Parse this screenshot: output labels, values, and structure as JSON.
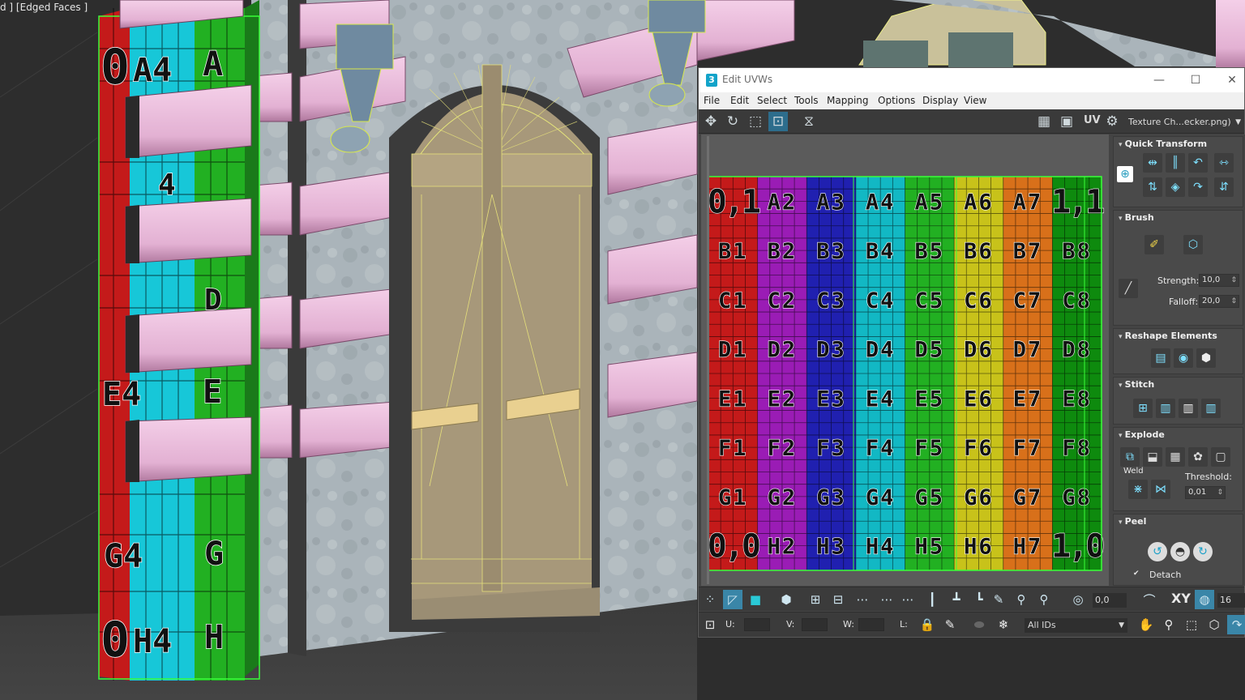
{
  "viewport": {
    "label": "d ] [Edged Faces ]",
    "left_column_labels": [
      "0",
      "A4",
      "A",
      "4",
      "D",
      "E4",
      "E",
      "G4",
      "G",
      "0",
      "H4",
      "H"
    ]
  },
  "window": {
    "logo": "3",
    "title": "Edit UVWs",
    "minimize": "—",
    "maximize": "☐",
    "close": "✕"
  },
  "menu": [
    "File",
    "Edit",
    "Select",
    "Tools",
    "Mapping",
    "Options",
    "Display",
    "View"
  ],
  "toolbar_top": {
    "uv_label": "UV",
    "texture": "Texture Ch...ecker.png)"
  },
  "checker": {
    "rows": [
      [
        "0,1",
        "A2",
        "A3",
        "A4",
        "A5",
        "A6",
        "A7",
        "1,1"
      ],
      [
        "B1",
        "B2",
        "B3",
        "B4",
        "B5",
        "B6",
        "B7",
        "B8"
      ],
      [
        "C1",
        "C2",
        "C3",
        "C4",
        "C5",
        "C6",
        "C7",
        "C8"
      ],
      [
        "D1",
        "D2",
        "D3",
        "D4",
        "D5",
        "D6",
        "D7",
        "D8"
      ],
      [
        "E1",
        "E2",
        "E3",
        "E4",
        "E5",
        "E6",
        "E7",
        "E8"
      ],
      [
        "F1",
        "F2",
        "F3",
        "F4",
        "F5",
        "F6",
        "F7",
        "F8"
      ],
      [
        "G1",
        "G2",
        "G3",
        "G4",
        "G5",
        "G6",
        "G7",
        "G8"
      ],
      [
        "0,0",
        "H2",
        "H3",
        "H4",
        "H5",
        "H6",
        "H7",
        "1,0"
      ]
    ],
    "column_colors": [
      "#c41a1a",
      "#9a1cb5",
      "#2020b0",
      "#12b8c4",
      "#22b022",
      "#c8c21a",
      "#d8701a",
      "#0e8a0e"
    ]
  },
  "panel": {
    "quick_transform": "Quick Transform",
    "brush": "Brush",
    "strength_label": "Strength:",
    "strength_value": "10,0",
    "falloff_label": "Falloff:",
    "falloff_value": "20,0",
    "reshape": "Reshape Elements",
    "stitch": "Stitch",
    "explode": "Explode",
    "weld": "Weld",
    "threshold_label": "Threshold:",
    "threshold_value": "0,01",
    "peel": "Peel",
    "detach": "Detach"
  },
  "bottom_bar": {
    "angle": "0,0",
    "xy": "XY",
    "grid": "16"
  },
  "status_bar": {
    "u": "U:",
    "v": "V:",
    "w": "W:",
    "l": "L:",
    "ids": "All IDs"
  }
}
